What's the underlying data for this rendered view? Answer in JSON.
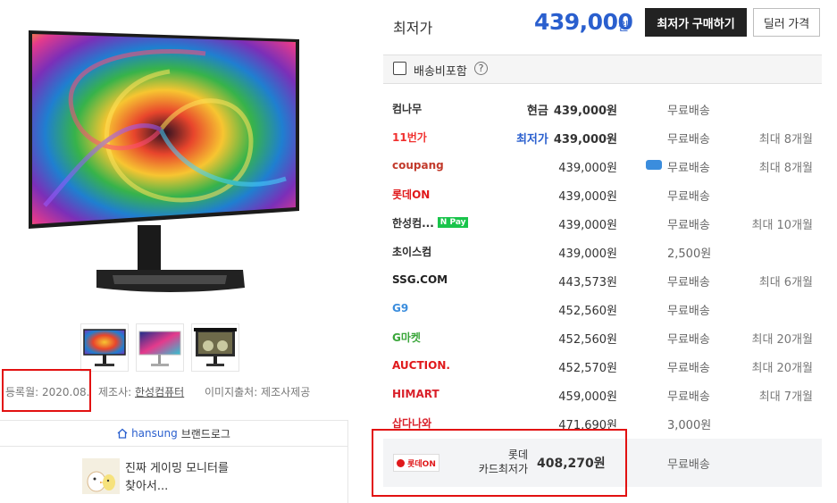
{
  "left": {
    "registered": "등록월: 2020.08.",
    "maker_label": "제조사:",
    "maker": "한성컴퓨터",
    "image_source": "이미지출처: 제조사제공",
    "brand_name": "hansung",
    "brand_link": "브랜드로그",
    "review_line1": "진짜 게이밍 모니터를",
    "review_line2": "찾아서..."
  },
  "header": {
    "lowest_label": "최저가",
    "lowest_price": "439,000",
    "won": "원",
    "buy_button": "최저가 구매하기",
    "dealer_button": "딜러 가격"
  },
  "shipping_filter": {
    "label": "배송비포함",
    "help": "?"
  },
  "sellers": [
    {
      "logo": "컴나무",
      "logo_color": "#333333",
      "label": "현금",
      "price": "439,000원",
      "bold": true,
      "label_blue": false,
      "ship": "무료배송",
      "installment": ""
    },
    {
      "logo": "11번가",
      "logo_color": "#f0302e",
      "label": "최저가",
      "price": "439,000원",
      "bold": true,
      "label_blue": true,
      "ship": "무료배송",
      "installment": "최대 8개월"
    },
    {
      "logo": "coupang",
      "logo_color": "#c23a2b",
      "label": "",
      "price": "439,000원",
      "bold": false,
      "label_blue": false,
      "ship": "무료배송",
      "installment": "최대 8개월",
      "rocket": true
    },
    {
      "logo": "롯데ON",
      "logo_color": "#e0191b",
      "label": "",
      "price": "439,000원",
      "bold": false,
      "label_blue": false,
      "ship": "무료배송",
      "installment": ""
    },
    {
      "logo": "한성컴...",
      "logo_color": "#333333",
      "label": "",
      "price": "439,000원",
      "bold": false,
      "label_blue": false,
      "ship": "무료배송",
      "installment": "최대 10개월",
      "npay": "N Pay"
    },
    {
      "logo": "초이스컴",
      "logo_color": "#2a2a2a",
      "label": "",
      "price": "439,000원",
      "bold": false,
      "label_blue": false,
      "ship": "2,500원",
      "installment": ""
    },
    {
      "logo": "SSG.COM",
      "logo_color": "#222222",
      "label": "",
      "price": "443,573원",
      "bold": false,
      "label_blue": false,
      "ship": "무료배송",
      "installment": "최대 6개월"
    },
    {
      "logo": "G9",
      "logo_color": "#3b8ddd",
      "label": "",
      "price": "452,560원",
      "bold": false,
      "label_blue": false,
      "ship": "무료배송",
      "installment": ""
    },
    {
      "logo": "G마켓",
      "logo_color": "#3aa63a",
      "label": "",
      "price": "452,560원",
      "bold": false,
      "label_blue": false,
      "ship": "무료배송",
      "installment": "최대 20개월"
    },
    {
      "logo": "AUCTION.",
      "logo_color": "#e0191b",
      "label": "",
      "price": "452,570원",
      "bold": false,
      "label_blue": false,
      "ship": "무료배송",
      "installment": "최대 20개월"
    },
    {
      "logo": "HIMART",
      "logo_color": "#d9202a",
      "label": "",
      "price": "459,000원",
      "bold": false,
      "label_blue": false,
      "ship": "무료배송",
      "installment": "최대 7개월"
    },
    {
      "logo": "삽다나와",
      "logo_color": "#d9202a",
      "label": "",
      "price": "471,690원",
      "bold": false,
      "label_blue": false,
      "ship": "3,000원",
      "installment": ""
    }
  ],
  "card": {
    "logo": "롯데ON",
    "label_line1": "롯데",
    "label_line2": "카드최저가",
    "price": "408,270원",
    "ship": "무료배송"
  },
  "colors": {
    "accent_blue": "#2a5fce",
    "highlight_red": "#e21111"
  }
}
